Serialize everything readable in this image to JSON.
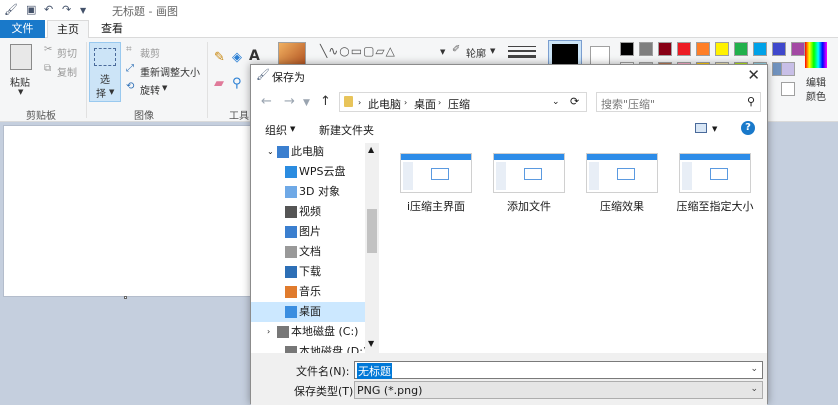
{
  "app": {
    "title": "无标题 - 画图",
    "tabs": [
      "文件",
      "主页",
      "查看"
    ]
  },
  "ribbon": {
    "clipboard": {
      "paste": "粘贴",
      "cut": "剪切",
      "copy": "复制",
      "label": "剪贴板"
    },
    "image": {
      "select": "选",
      "select2": "择",
      "crop": "裁剪",
      "resize": "重新调整大小",
      "rotate": "旋转",
      "label": "图像"
    },
    "tools": {
      "label": "工具"
    },
    "shapes": {
      "outline": "轮廓"
    },
    "colors": {
      "edit": "编辑",
      "edit2": "颜色"
    }
  },
  "palette": [
    "#000000",
    "#7f7f7f",
    "#880015",
    "#ed1c24",
    "#ff7f27",
    "#fff200",
    "#22b14c",
    "#00a2e8",
    "#3f48cc",
    "#a349a4"
  ],
  "dialog": {
    "title": "保存为",
    "path": [
      "此电脑",
      "桌面",
      "压缩"
    ],
    "search_placeholder": "搜索\"压缩\"",
    "organize": "组织",
    "new_folder": "新建文件夹",
    "tree": [
      {
        "label": "此电脑",
        "icon": "computer-icon"
      },
      {
        "label": "WPS云盘",
        "icon": "cloud-icon"
      },
      {
        "label": "3D 对象",
        "icon": "3d-objects-icon"
      },
      {
        "label": "视频",
        "icon": "video-icon"
      },
      {
        "label": "图片",
        "icon": "picture-icon"
      },
      {
        "label": "文档",
        "icon": "document-icon"
      },
      {
        "label": "下载",
        "icon": "download-icon"
      },
      {
        "label": "音乐",
        "icon": "music-icon"
      },
      {
        "label": "桌面",
        "icon": "desktop-icon"
      },
      {
        "label": "本地磁盘 (C:)",
        "icon": "drive-icon"
      },
      {
        "label": "本地磁盘 (D:)",
        "icon": "drive-icon"
      }
    ],
    "files": [
      "i压缩主界面",
      "添加文件",
      "压缩效果",
      "压缩至指定大小"
    ],
    "filename_label": "文件名(N):",
    "filename": "无标题",
    "filetype_label": "保存类型(T):",
    "filetype": "PNG (*.png)"
  }
}
